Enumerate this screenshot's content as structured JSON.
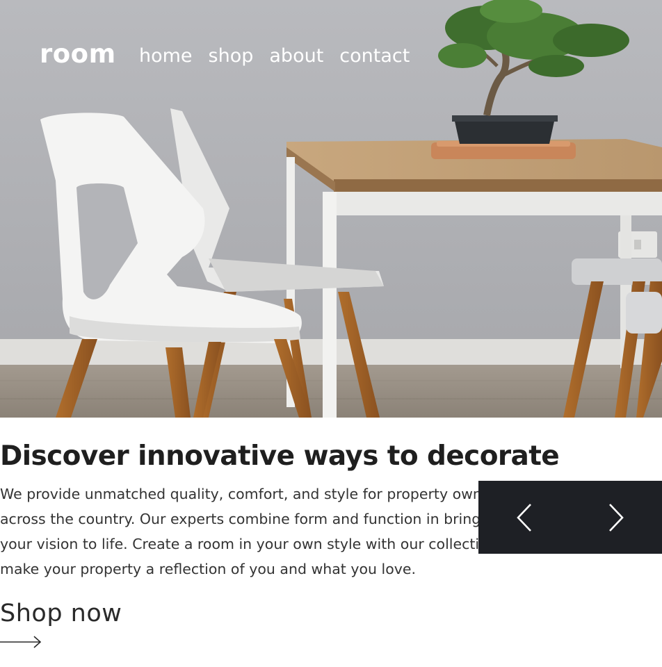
{
  "header": {
    "logo": "room",
    "nav": [
      {
        "label": "home"
      },
      {
        "label": "shop"
      },
      {
        "label": "about"
      },
      {
        "label": "contact"
      }
    ]
  },
  "hero": {
    "image": "interior-dining-room-photo"
  },
  "content": {
    "headline": "Discover innovative ways to decorate",
    "description": "We provide unmatched quality, comfort, and style for property owners across the country. Our experts combine form and function in bringing your vision to life. Create a room in your own style with our collection and make your property a reflection of you and what you love.",
    "cta_label": "Shop now",
    "cta_icon": "arrow-right-icon"
  },
  "slider": {
    "prev_icon": "chevron-left-icon",
    "next_icon": "chevron-right-icon"
  },
  "colors": {
    "dark": "#1e2025",
    "text": "#1f1f1f",
    "white": "#ffffff"
  }
}
